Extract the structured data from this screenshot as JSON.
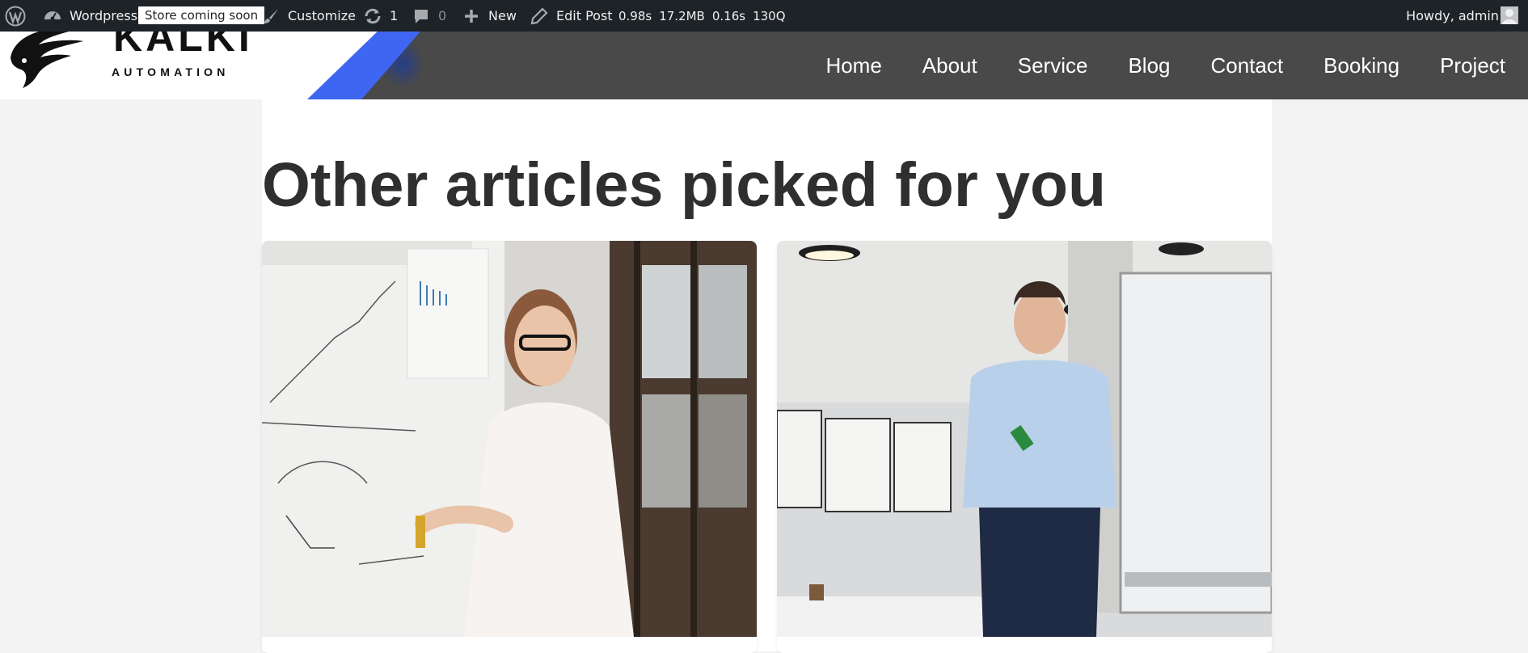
{
  "adminbar": {
    "site_name": "Wordpress",
    "store_badge": "Store coming soon",
    "customize": "Customize",
    "updates_count": "1",
    "comments_count": "0",
    "new_label": "New",
    "edit_post": "Edit Post",
    "perf": [
      "0.98s",
      "17.2MB",
      "0.16s",
      "130Q"
    ],
    "howdy": "Howdy, admin",
    "icons": [
      "wordpress-icon",
      "dashboard-icon",
      "brush-icon",
      "refresh-icon",
      "comment-icon",
      "plus-icon",
      "pencil-icon",
      "avatar-icon"
    ]
  },
  "header": {
    "logo_title": "KALKI",
    "logo_tagline": "AUTOMATION",
    "accent_color": "#3f66f2",
    "nav": [
      "Home",
      "About",
      "Service",
      "Blog",
      "Contact",
      "Booking",
      "Project"
    ]
  },
  "main": {
    "section_title": "Other articles picked for you",
    "cards": [
      {
        "image": "woman-presenting-at-flipchart-photo"
      },
      {
        "image": "man-standing-by-whiteboard-photo"
      }
    ]
  }
}
